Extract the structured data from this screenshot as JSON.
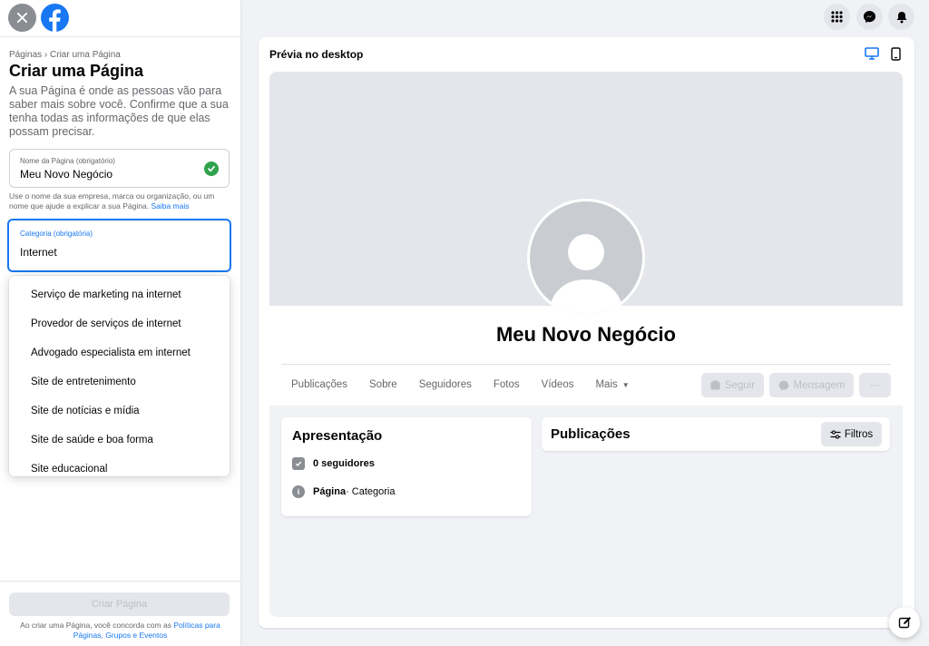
{
  "left": {
    "breadcrumb": "Páginas › Criar uma Página",
    "title": "Criar uma Página",
    "intro": "A sua Página é onde as pessoas vão para saber mais sobre você. Confirme que a sua tenha todas as informações de que elas possam precisar.",
    "name_field": {
      "label": "Nome da Página (obrigatório)",
      "value": "Meu Novo Negócio"
    },
    "helper": "Use o nome da sua empresa, marca ou organização, ou um nome que ajude a explicar a sua Página.",
    "helper_link": "Saiba mais",
    "category_field": {
      "label": "Categoria (obrigatória)",
      "value": "Internet"
    },
    "dropdown_options": [
      "Serviço de marketing na internet",
      "Provedor de serviços de internet",
      "Advogado especialista em internet",
      "Site de entretenimento",
      "Site de notícias e mídia",
      "Site de saúde e boa forma",
      "Site educacional"
    ],
    "create_button": "Criar Página",
    "terms": "Ao criar uma Página, você concorda com as",
    "terms_link": "Políticas para Páginas, Grupos e Eventos"
  },
  "preview": {
    "title": "Prévia no desktop",
    "page_name": "Meu Novo Negócio",
    "tabs": [
      "Publicações",
      "Sobre",
      "Seguidores",
      "Fotos",
      "Vídeos",
      "Mais"
    ],
    "follow_button": "Seguir",
    "message_button": "Mensagem",
    "more_button": "···",
    "intro_card": {
      "title": "Apresentação",
      "followers": "0 seguidores",
      "page_label": "Página",
      "category": " · Categoria"
    },
    "posts_card": {
      "title": "Publicações",
      "filter_button": "Filtros"
    }
  },
  "colors": {
    "accent": "#1877f2",
    "success": "#31a24c",
    "disabled": "#e4e6eb"
  }
}
